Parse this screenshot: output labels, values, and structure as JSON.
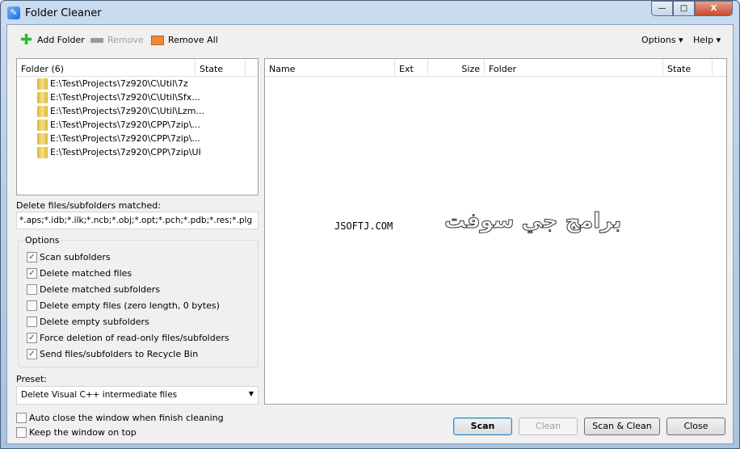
{
  "window": {
    "title": "Folder Cleaner",
    "minimize": "—",
    "maximize": "□",
    "close": "X"
  },
  "toolbar": {
    "add_folder": "Add Folder",
    "remove": "Remove",
    "remove_all": "Remove All",
    "options": "Options ▾",
    "help": "Help ▾"
  },
  "folders": {
    "header_folder": "Folder (6)",
    "header_state": "State",
    "items": [
      "E:\\Test\\Projects\\7z920\\C\\Util\\7z",
      "E:\\Test\\Projects\\7z920\\C\\Util\\Sfx...",
      "E:\\Test\\Projects\\7z920\\C\\Util\\Lzm...",
      "E:\\Test\\Projects\\7z920\\CPP\\7zip\\...",
      "E:\\Test\\Projects\\7z920\\CPP\\7zip\\...",
      "E:\\Test\\Projects\\7z920\\CPP\\7zip\\UI"
    ]
  },
  "match": {
    "label": "Delete files/subfolders matched:",
    "value": "*.aps;*.idb;*.ilk;*.ncb;*.obj;*.opt;*.pch;*.pdb;*.res;*.plg"
  },
  "options": {
    "title": "Options",
    "items": [
      {
        "label": "Scan subfolders",
        "checked": true
      },
      {
        "label": "Delete matched files",
        "checked": true
      },
      {
        "label": "Delete matched subfolders",
        "checked": false
      },
      {
        "label": "Delete empty files (zero length, 0 bytes)",
        "checked": false
      },
      {
        "label": "Delete empty subfolders",
        "checked": false
      },
      {
        "label": "Force deletion of read-only files/subfolders",
        "checked": true
      },
      {
        "label": "Send files/subfolders to Recycle Bin",
        "checked": true
      }
    ]
  },
  "preset": {
    "label": "Preset:",
    "value": "Delete Visual C++ intermediate files"
  },
  "bottom": {
    "auto_close": "Auto close the window when finish cleaning",
    "keep_on_top": "Keep the window on top"
  },
  "results": {
    "columns": [
      "Name",
      "Ext",
      "Size",
      "Folder",
      "State"
    ]
  },
  "watermark": {
    "latin": "JSOFTJ.COM",
    "arabic": "برامج جي سوفت"
  },
  "buttons": {
    "scan": "Scan",
    "clean": "Clean",
    "scan_clean": "Scan & Clean",
    "close": "Close"
  }
}
